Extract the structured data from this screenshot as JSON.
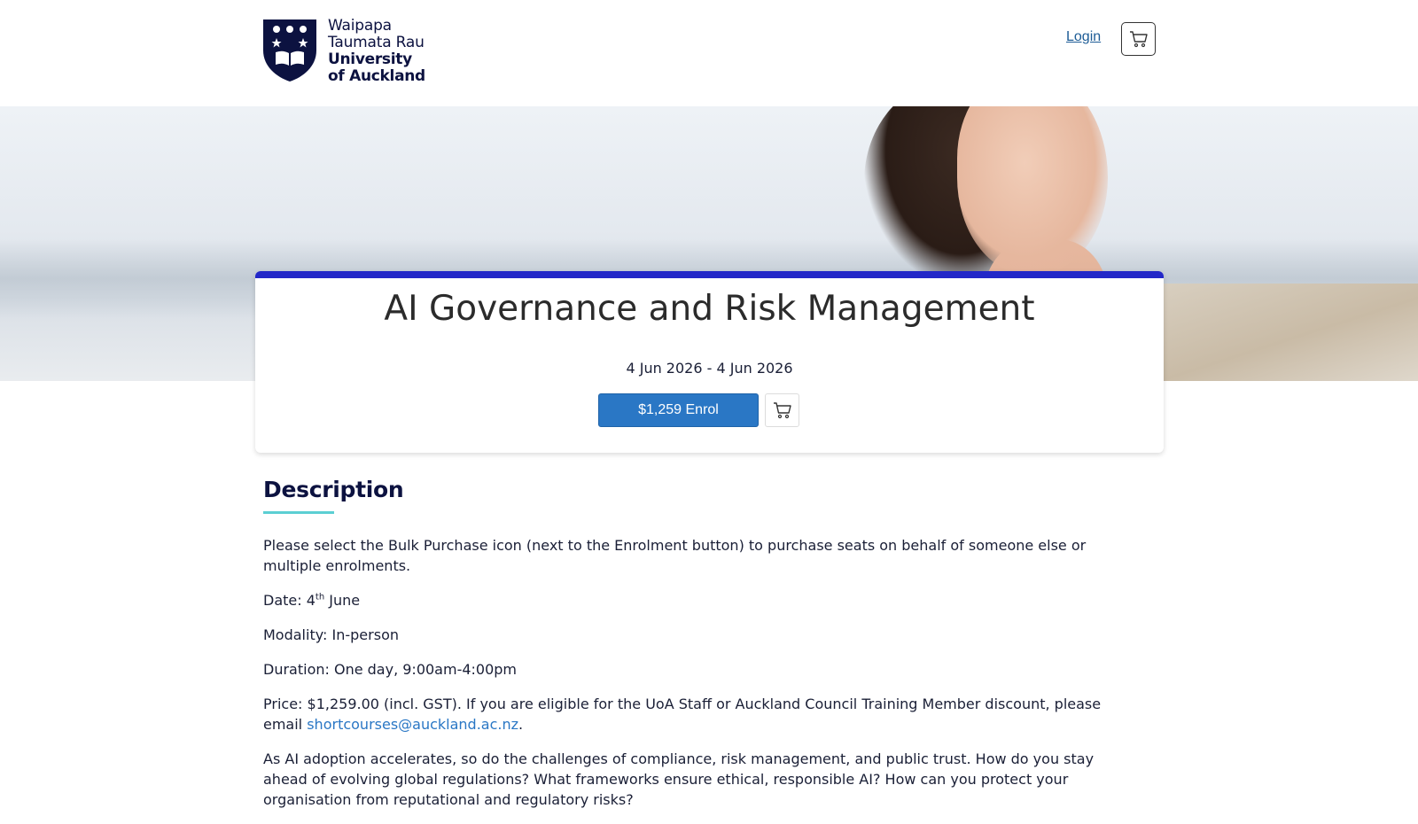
{
  "header": {
    "logo": {
      "line1": "Waipapa",
      "line2": "Taumata Rau",
      "line3": "University",
      "line4": "of Auckland"
    },
    "login_label": "Login",
    "cart_icon": "cart-icon"
  },
  "course": {
    "title": "AI Governance and Risk Management",
    "dates": "4 Jun 2026 - 4 Jun 2026",
    "enrol_label": "$1,259 Enrol",
    "bulk_icon": "cart-icon",
    "accent_color": "#2328c8",
    "button_color": "#2a77c5"
  },
  "description": {
    "heading": "Description",
    "intro": "Please select the Bulk Purchase icon (next to the Enrolment button) to purchase seats on behalf of someone else or multiple enrolments.",
    "date_label": "Date:",
    "date_day": "4",
    "date_suffix": "th",
    "date_month": "June",
    "modality_label": "Modality:",
    "modality_value": "In-person",
    "duration_label": "Duration:",
    "duration_value": "One day, 9:00am-4:00pm",
    "price_text": "Price: $1,259.00 (incl. GST). If you are eligible for the UoA Staff or Auckland Council Training Member discount, please email",
    "email": "shortcourses@auckland.ac.nz",
    "price_end": ".",
    "body": "As AI adoption accelerates, so do the challenges of compliance, risk management, and public trust. How do you stay ahead of evolving global regulations? What frameworks ensure ethical, responsible AI? How can you protect your organisation from reputational and regulatory risks?"
  }
}
